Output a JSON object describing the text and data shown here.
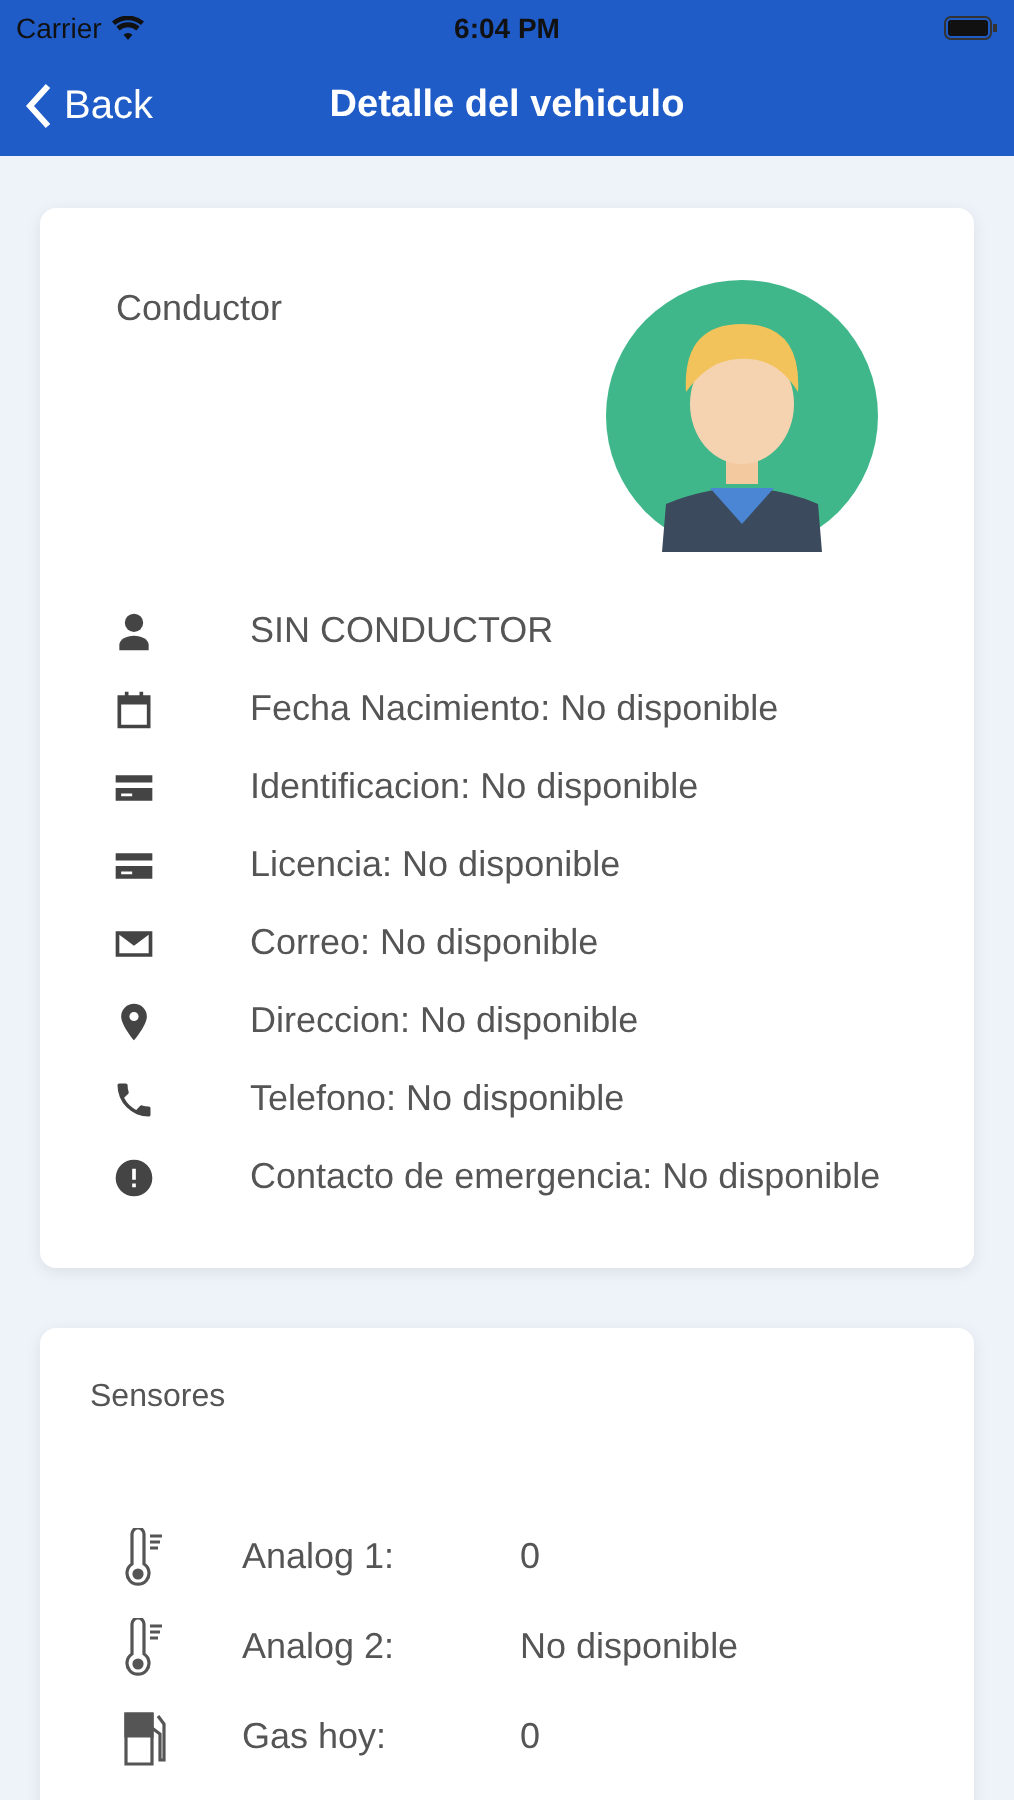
{
  "status_bar": {
    "carrier": "Carrier",
    "time": "6:04 PM"
  },
  "nav": {
    "back": "Back",
    "title": "Detalle del vehiculo"
  },
  "driver_card": {
    "title": "Conductor",
    "rows": [
      {
        "kind": "person",
        "text": "SIN CONDUCTOR"
      },
      {
        "kind": "calendar",
        "text": "Fecha Nacimiento: No disponible"
      },
      {
        "kind": "card",
        "text": "Identificacion: No disponible"
      },
      {
        "kind": "card",
        "text": "Licencia: No disponible"
      },
      {
        "kind": "mail",
        "text": "Correo: No disponible"
      },
      {
        "kind": "pin",
        "text": "Direccion: No disponible"
      },
      {
        "kind": "phone",
        "text": "Telefono: No disponible"
      },
      {
        "kind": "alert",
        "text": "Contacto de emergencia: No disponible"
      }
    ]
  },
  "sensors_card": {
    "title": "Sensores",
    "rows": [
      {
        "kind": "thermometer",
        "label": "Analog 1:",
        "value": "0"
      },
      {
        "kind": "thermometer",
        "label": "Analog 2:",
        "value": "No disponible"
      },
      {
        "kind": "fuel",
        "label": "Gas hoy:",
        "value": "0"
      }
    ]
  }
}
